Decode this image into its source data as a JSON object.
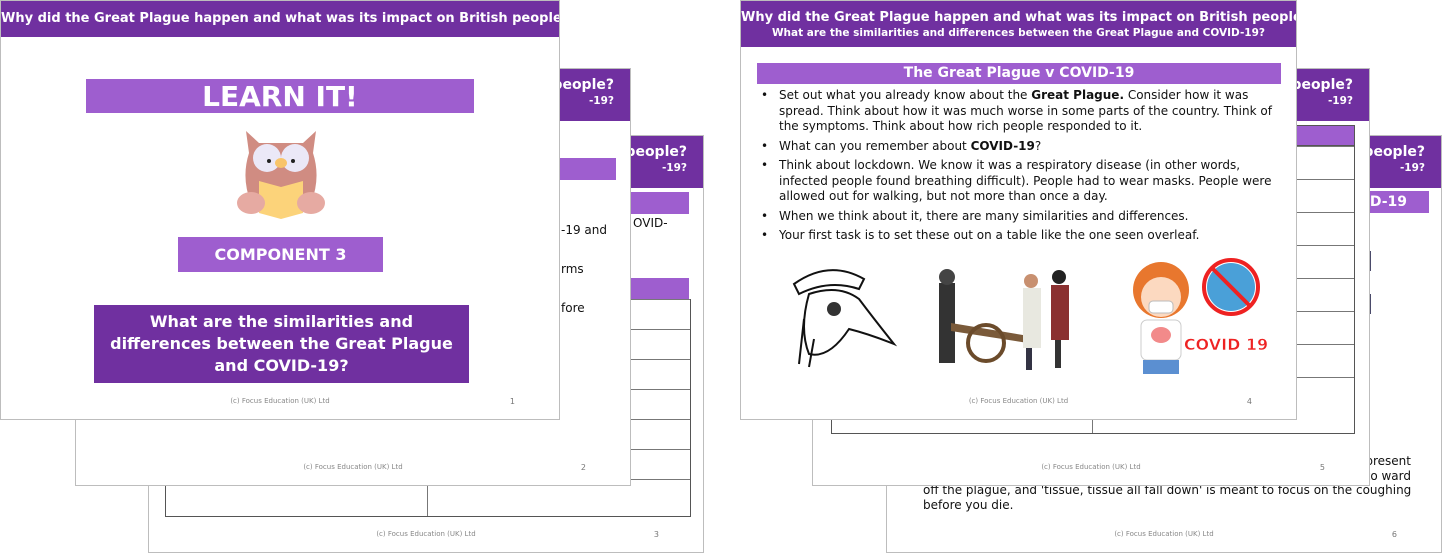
{
  "header_title": "Why did the Great Plague happen and what was its impact on British people?",
  "header_subtitle": "What are the similarities and differences between the Great Plague and COVID-19?",
  "footer": "(c) Focus Education (UK) Ltd",
  "colors": {
    "header": "#7030a0",
    "accent": "#9e5ecf"
  },
  "slide1": {
    "banner": "LEARN IT!",
    "icon": "owl-reading-icon",
    "component": "COMPONENT 3",
    "question": "What are the similarities and differences between the Great Plague and COVID-19?",
    "number": "1"
  },
  "slide2": {
    "header_frag": "people?",
    "sub_frag": "-19?",
    "frags": [
      "-19 and",
      "rms",
      "fore"
    ],
    "number": "2"
  },
  "slide3": {
    "header_frag": "people?",
    "sub_frag": "-19?",
    "frags": [
      "OVID-"
    ],
    "number": "3"
  },
  "slide4": {
    "bar": "The Great Plague v COVID-19",
    "bullets": [
      {
        "pre": "Set out what you already know about the ",
        "bold": "Great Plague.",
        "post": " Consider how it was spread. Think about how it was much worse in some parts of the country. Think of the symptoms. Think about how rich people responded to it."
      },
      {
        "pre": "What can you remember about ",
        "bold": "COVID-19",
        "post": "?"
      },
      {
        "pre": "Think about lockdown. We know it was a respiratory disease (in other words, infected people found breathing difficult). People had to wear masks. People were allowed out for walking, but not more than once a day.",
        "bold": "",
        "post": ""
      },
      {
        "pre": "When we think about it, there are many similarities and differences.",
        "bold": "",
        "post": ""
      },
      {
        "pre": "Your first task is to set these out on a table like the one seen overleaf.",
        "bold": "",
        "post": ""
      }
    ],
    "images": [
      "plague-doctor-image",
      "plague-cart-image",
      "covid-girl-image"
    ],
    "covid_label": "COVID 19",
    "number": "4"
  },
  "slide5": {
    "header_frag": "people?",
    "sub_frag": "-19?",
    "number": "5"
  },
  "slide6": {
    "header_frag": "people?",
    "sub_frag": "-19?",
    "bar_frag": "D-19",
    "lines": [
      "present",
      "to ward",
      "off the plague, and 'tissue, tissue all fall down' is meant to focus on the coughing",
      "before you die."
    ],
    "number": "6"
  }
}
